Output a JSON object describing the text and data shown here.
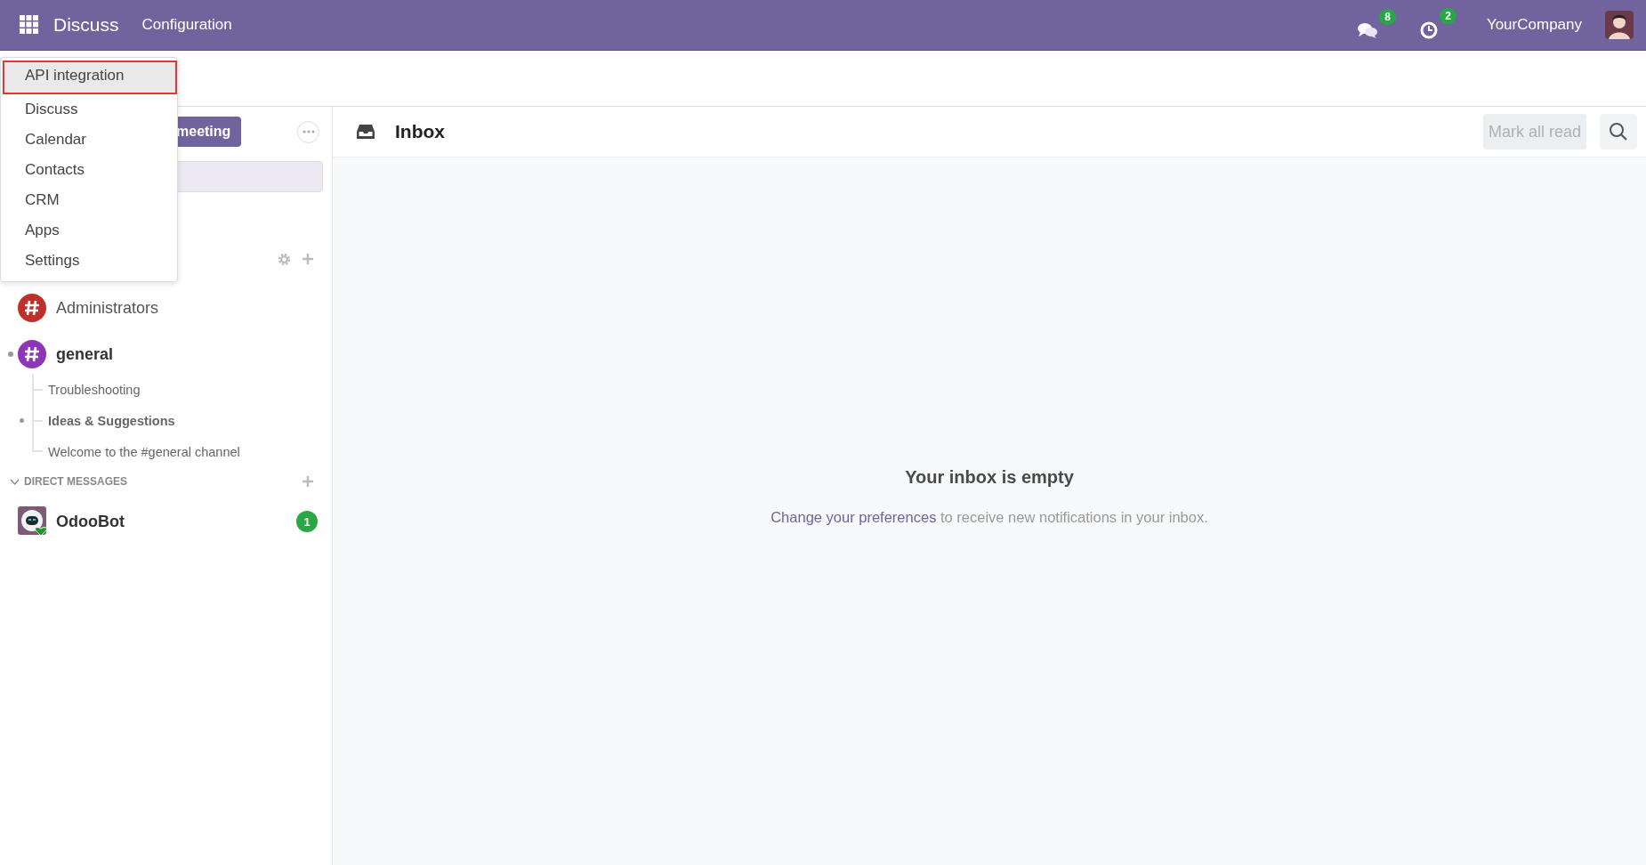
{
  "navbar": {
    "app_name": "Discuss",
    "menu": [
      "Configuration"
    ],
    "messages_count": "8",
    "activities_count": "2",
    "company": "YourCompany"
  },
  "apps_menu": {
    "items": [
      {
        "label": "API integration",
        "selected": true
      },
      {
        "label": "Discuss",
        "selected": false
      },
      {
        "label": "Calendar",
        "selected": false
      },
      {
        "label": "Contacts",
        "selected": false
      },
      {
        "label": "CRM",
        "selected": false
      },
      {
        "label": "Apps",
        "selected": false
      },
      {
        "label": "Settings",
        "selected": false
      }
    ]
  },
  "sidebar": {
    "meeting_button": "meeting",
    "channels": [
      {
        "name": "Administrators",
        "color": "#c0302b",
        "unread": false
      },
      {
        "name": "general",
        "color": "#8e35b8",
        "unread": true,
        "children": [
          {
            "name": "Troubleshooting",
            "unread": false
          },
          {
            "name": "Ideas & Suggestions",
            "unread": true
          },
          {
            "name": "Welcome to the #general channel",
            "unread": false
          }
        ]
      }
    ],
    "direct_messages": {
      "title": "DIRECT MESSAGES",
      "expanded": true,
      "items": [
        {
          "name": "OdooBot",
          "online": true,
          "badge": "1"
        }
      ]
    }
  },
  "inbox": {
    "title": "Inbox",
    "mark_all_read": "Mark all read",
    "empty_title": "Your inbox is empty",
    "link": "Change your preferences",
    "message": "to receive new notifications in your inbox."
  }
}
